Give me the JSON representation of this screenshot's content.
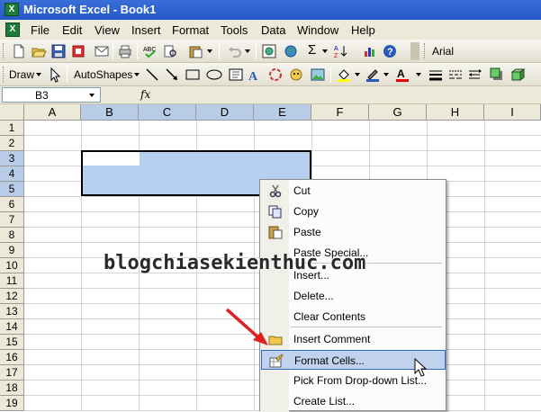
{
  "window": {
    "title": "Microsoft Excel - Book1"
  },
  "menu": [
    "File",
    "Edit",
    "View",
    "Insert",
    "Format",
    "Tools",
    "Data",
    "Window",
    "Help"
  ],
  "toolbar": {
    "font_name": "Arial",
    "sigma": "Σ",
    "draw_label": "Draw",
    "autoshapes_label": "AutoShapes"
  },
  "formula_bar": {
    "name_box": "B3",
    "fx_label": "fx",
    "value": ""
  },
  "sheet": {
    "columns": [
      "A",
      "B",
      "C",
      "D",
      "E",
      "F",
      "G",
      "H",
      "I"
    ],
    "rows": [
      "1",
      "2",
      "3",
      "4",
      "5",
      "6",
      "7",
      "8",
      "9",
      "10",
      "11",
      "12",
      "13",
      "14",
      "15",
      "16",
      "17",
      "18",
      "19"
    ],
    "selected_range": "B3:E5",
    "active_cell": "B3"
  },
  "context_menu": {
    "items": [
      {
        "label": "Cut",
        "icon": "scissors-icon"
      },
      {
        "label": "Copy",
        "icon": "copy-icon"
      },
      {
        "label": "Paste",
        "icon": "paste-icon"
      },
      {
        "label": "Paste Special...",
        "icon": ""
      },
      {
        "label": "Insert...",
        "icon": ""
      },
      {
        "label": "Delete...",
        "icon": ""
      },
      {
        "label": "Clear Contents",
        "icon": ""
      },
      {
        "label": "Insert Comment",
        "icon": "comment-icon"
      },
      {
        "label": "Format Cells...",
        "icon": "format-cells-icon",
        "highlighted": true
      },
      {
        "label": "Pick From Drop-down List...",
        "icon": ""
      },
      {
        "label": "Create List...",
        "icon": ""
      }
    ]
  },
  "watermark": "blogchiasekienthuc.com",
  "colors": {
    "title_bar": "#2458c8",
    "selection": "#b8d0f0",
    "menu_highlight": "#c1d2ee",
    "arrow": "#e02020"
  }
}
